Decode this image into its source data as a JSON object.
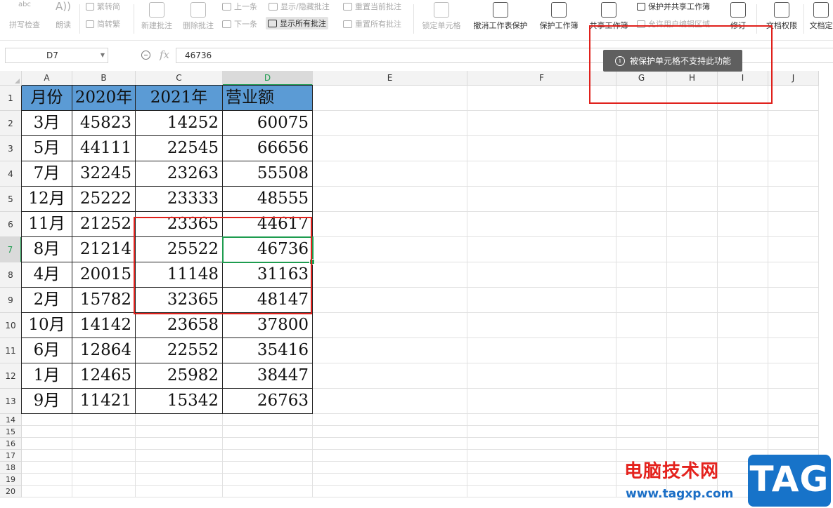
{
  "ribbon": {
    "spell_check": "拼写检查",
    "read_aloud": "朗读",
    "trad_to_simp": "繁转简",
    "simp_to_trad": "简转繁",
    "new_comment": "新建批注",
    "delete_comment": "删除批注",
    "prev_comment": "上一条",
    "next_comment": "下一条",
    "show_hide_comment": "显示/隐藏批注",
    "show_all_comments": "显示所有批注",
    "reset_current_comment": "重置当前批注",
    "reset_all_comments": "重置所有批注",
    "lock_cell": "锁定单元格",
    "unprotect_sheet": "撤消工作表保护",
    "protect_workbook": "保护工作簿",
    "share_workbook": "共享工作簿",
    "protect_and_share": "保护并共享工作簿",
    "allow_edit_ranges": "允许用户编辑区域",
    "track_changes": "修订",
    "doc_permissions": "文档权限",
    "doc_finalize": "文档定"
  },
  "formula_bar": {
    "name_box": "D7",
    "fx_label": "fx",
    "value": "46736"
  },
  "columns": [
    "A",
    "B",
    "C",
    "D",
    "E",
    "F",
    "G",
    "H",
    "I",
    "J"
  ],
  "rows": [
    "1",
    "2",
    "3",
    "4",
    "5",
    "6",
    "7",
    "8",
    "9",
    "10",
    "11",
    "12",
    "13",
    "14",
    "15",
    "16",
    "17",
    "18",
    "19",
    "20"
  ],
  "table": {
    "headers": [
      "月份",
      "2020年",
      "2021年",
      "营业额"
    ],
    "rows": [
      [
        "3月",
        "45823",
        "14252",
        "60075"
      ],
      [
        "5月",
        "44111",
        "22545",
        "66656"
      ],
      [
        "7月",
        "32245",
        "23263",
        "55508"
      ],
      [
        "12月",
        "25222",
        "23333",
        "48555"
      ],
      [
        "11月",
        "21252",
        "23365",
        "44617"
      ],
      [
        "8月",
        "21214",
        "25522",
        "46736"
      ],
      [
        "4月",
        "20015",
        "11148",
        "31163"
      ],
      [
        "2月",
        "15782",
        "32365",
        "48147"
      ],
      [
        "10月",
        "14142",
        "23658",
        "37800"
      ],
      [
        "6月",
        "12864",
        "22552",
        "35416"
      ],
      [
        "1月",
        "12465",
        "25982",
        "38447"
      ],
      [
        "9月",
        "11421",
        "15342",
        "26763"
      ]
    ]
  },
  "toast": {
    "message": "被保护单元格不支持此功能"
  },
  "watermark": {
    "site_name": "电脑技术网",
    "url": "www.tagxp.com",
    "badge": "TAG"
  },
  "colors": {
    "header_fill": "#5b9bd5",
    "selection": "#1e9c4f",
    "annotation": "#e0201b"
  }
}
